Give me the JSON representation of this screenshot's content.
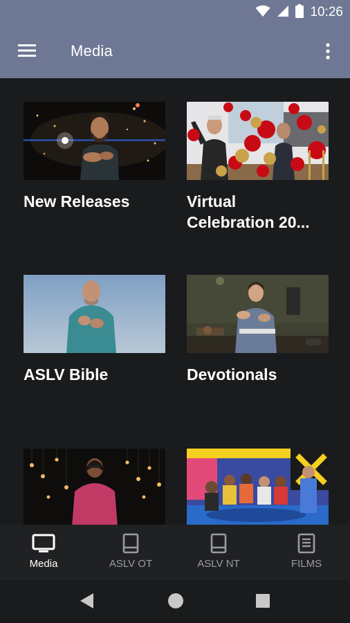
{
  "status_bar": {
    "time": "10:26",
    "icons": [
      "wifi-icon",
      "signal-icon",
      "battery-icon"
    ]
  },
  "app_bar": {
    "title": "Media",
    "menu_icon": "hamburger-menu-icon",
    "overflow_icon": "more-vert-icon"
  },
  "cards": [
    {
      "title": "New Releases",
      "thumbnail": "man-signing-dark-stage-with-lights"
    },
    {
      "title": "Virtual Celebration 20...",
      "thumbnail": "people-celebrating-with-balloons"
    },
    {
      "title": "ASLV Bible",
      "thumbnail": "bald-man-signing-blue-background"
    },
    {
      "title": "Devotionals",
      "thumbnail": "woman-signing-in-room"
    },
    {
      "title": "",
      "thumbnail": "woman-signing-with-string-lights"
    },
    {
      "title": "",
      "thumbnail": "group-signing-colorful-set"
    }
  ],
  "bottom_nav": [
    {
      "label": "Media",
      "icon": "tv-icon",
      "active": true
    },
    {
      "label": "ASLV OT",
      "icon": "book-icon",
      "active": false
    },
    {
      "label": "ASLV NT",
      "icon": "book-icon",
      "active": false
    },
    {
      "label": "FILMS",
      "icon": "film-book-icon",
      "active": false
    }
  ],
  "system_nav": [
    "back-icon",
    "home-icon",
    "recents-icon"
  ],
  "colors": {
    "app_bar": "#6e7894",
    "background": "#1a1b1d",
    "nav_bg": "#202123",
    "nav_active": "#ffffff",
    "nav_inactive": "#9a9ca0"
  }
}
